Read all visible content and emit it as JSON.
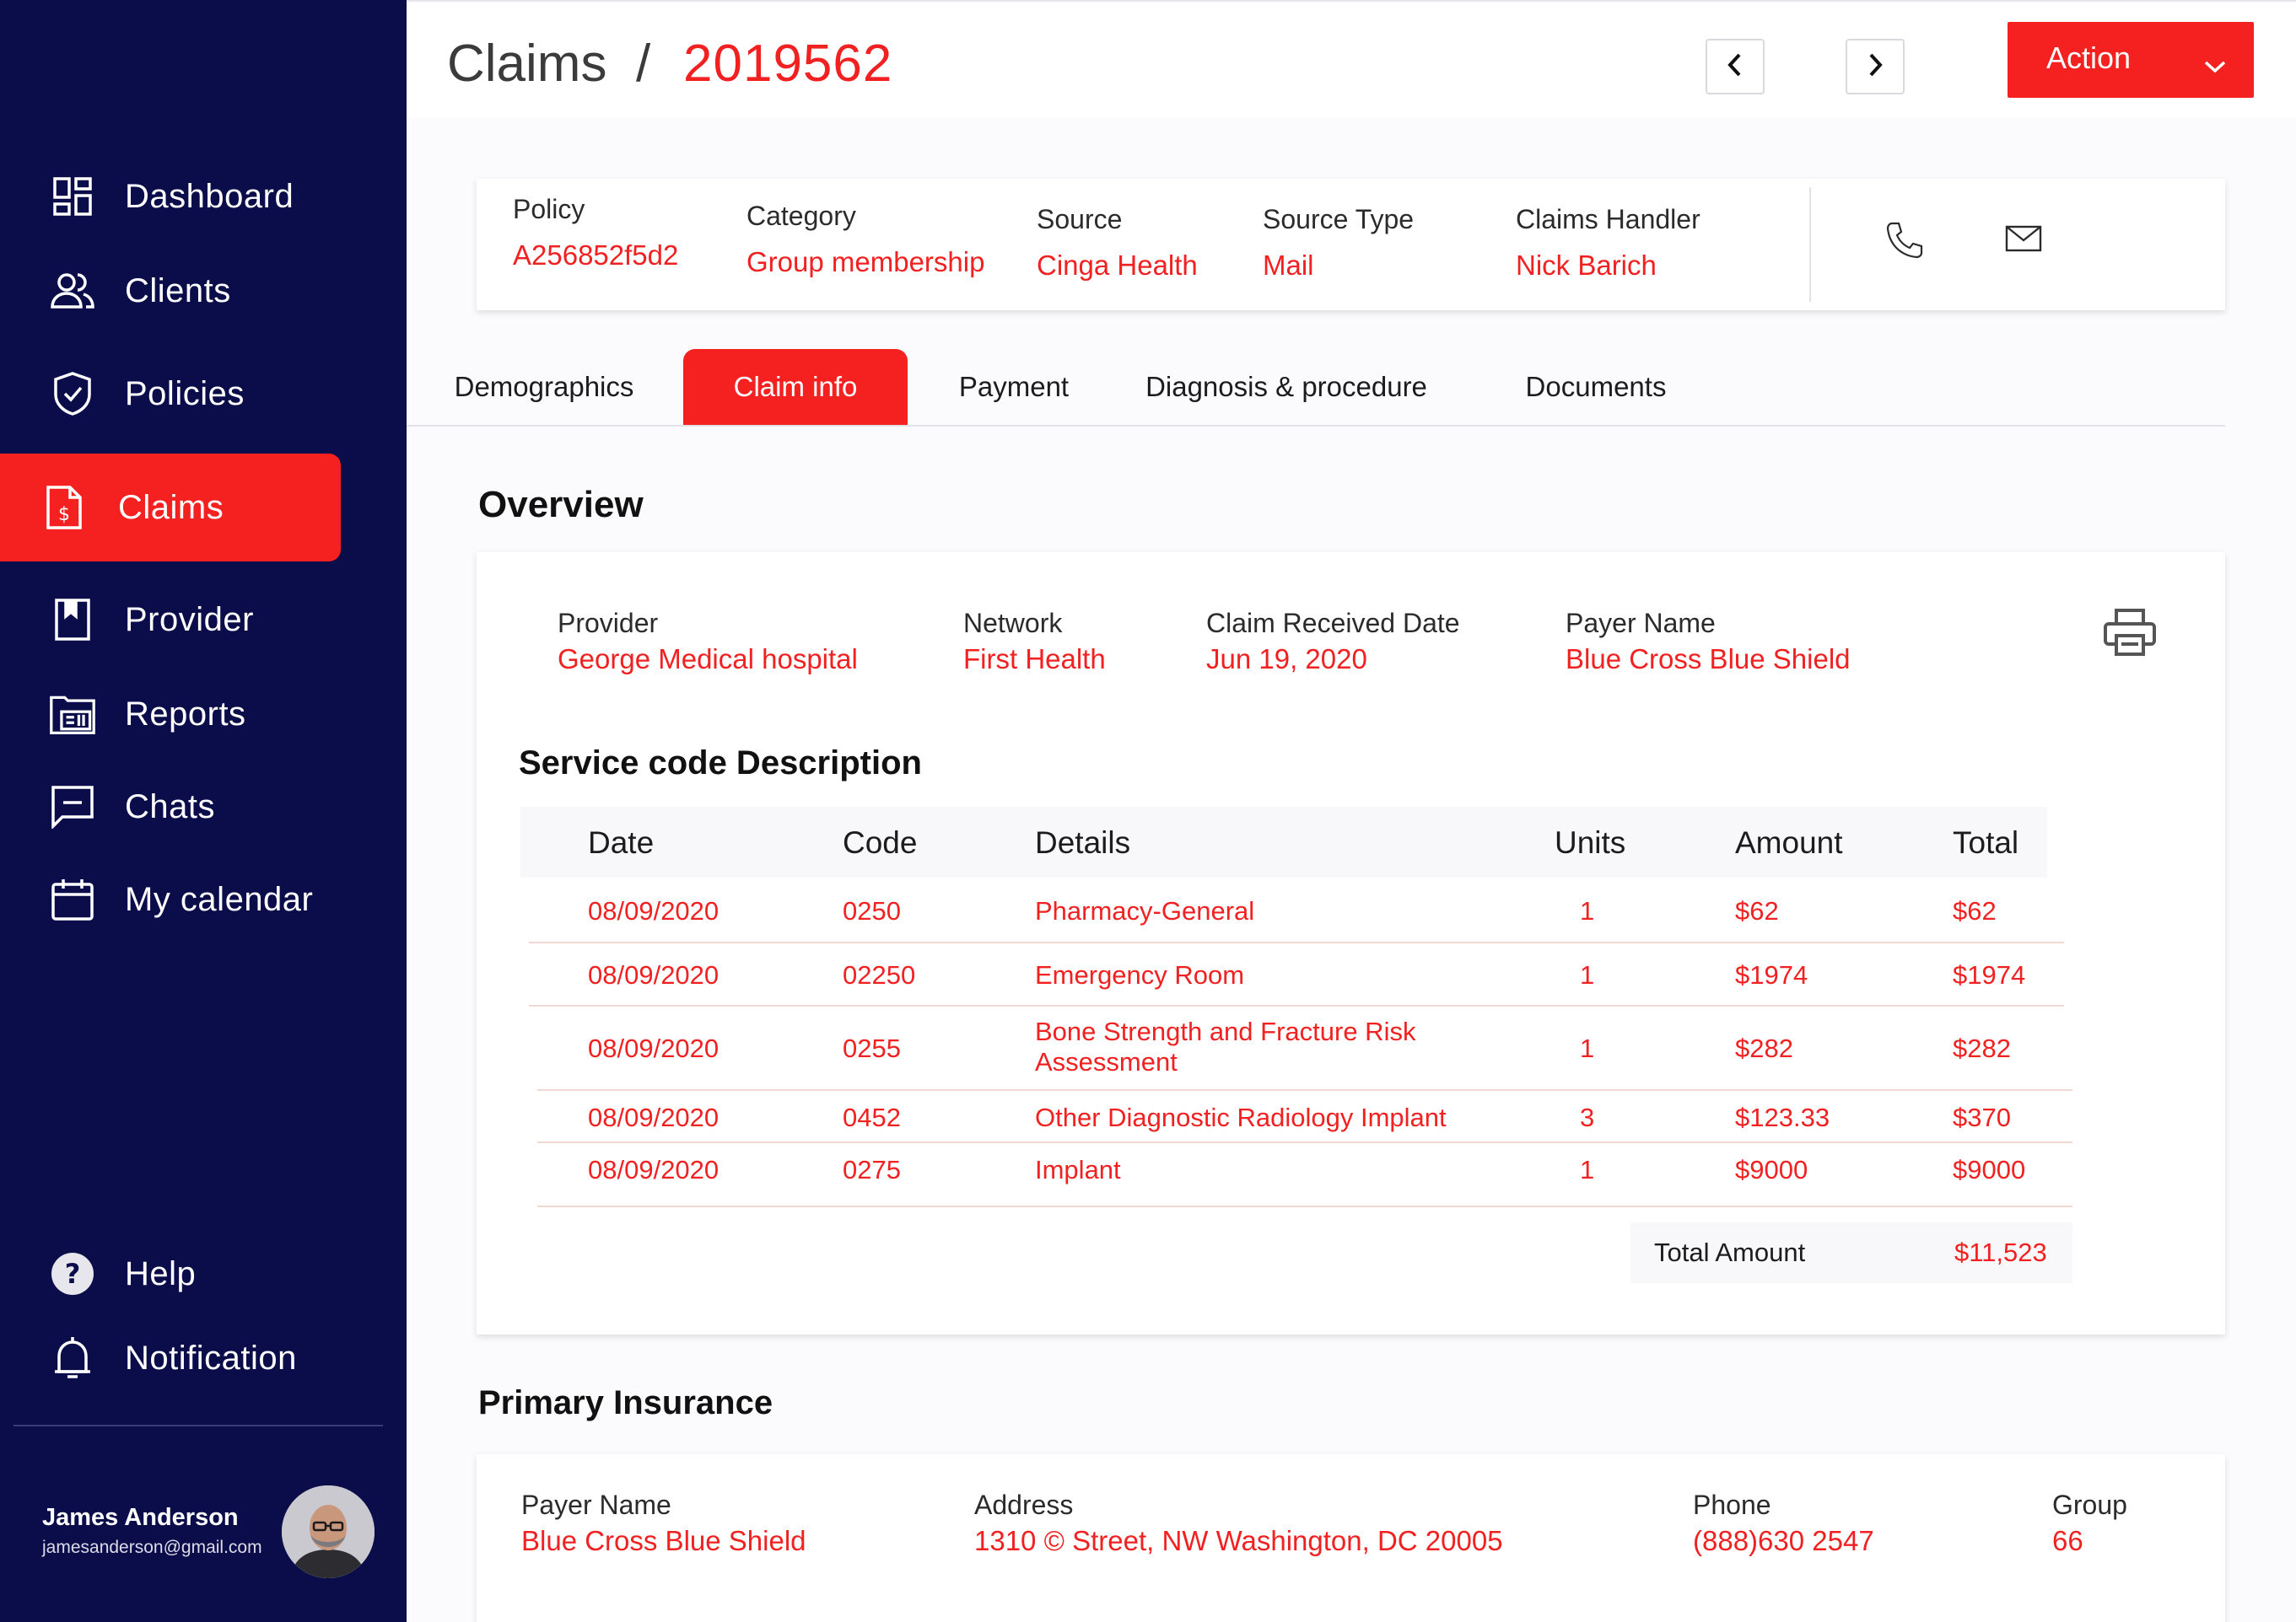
{
  "sidebar": {
    "items": [
      {
        "label": "Dashboard",
        "icon": "dashboard-icon"
      },
      {
        "label": "Clients",
        "icon": "clients-icon"
      },
      {
        "label": "Policies",
        "icon": "shield-icon"
      },
      {
        "label": "Claims",
        "icon": "claim-document-icon",
        "active": true
      },
      {
        "label": "Provider",
        "icon": "bookmark-icon"
      },
      {
        "label": "Reports",
        "icon": "reports-icon"
      },
      {
        "label": "Chats",
        "icon": "chat-icon"
      },
      {
        "label": "My calendar",
        "icon": "calendar-icon"
      }
    ],
    "bottom_items": [
      {
        "label": "Help",
        "icon": "help-icon"
      },
      {
        "label": "Notification",
        "icon": "bell-icon"
      }
    ],
    "profile": {
      "name": "James Anderson",
      "email": "jamesanderson@gmail.com"
    }
  },
  "header": {
    "crumb_root": "Claims",
    "crumb_sep": "/",
    "claim_id": "2019562",
    "action_label": "Action"
  },
  "info": {
    "policy": {
      "label": "Policy",
      "value": "A256852f5d2"
    },
    "category": {
      "label": "Category",
      "value": "Group membership"
    },
    "source": {
      "label": "Source",
      "value": "Cinga Health"
    },
    "source_type": {
      "label": "Source Type",
      "value": "Mail"
    },
    "handler": {
      "label": "Claims Handler",
      "value": "Nick Barich"
    }
  },
  "tabs": [
    "Demographics",
    "Claim info",
    "Payment",
    "Diagnosis & procedure",
    "Documents"
  ],
  "active_tab": "Claim info",
  "overview": {
    "title": "Overview",
    "provider": {
      "label": "Provider",
      "value": "George Medical hospital"
    },
    "network": {
      "label": "Network",
      "value": "First Health"
    },
    "received": {
      "label": "Claim Received Date",
      "value": "Jun 19, 2020"
    },
    "payer": {
      "label": "Payer Name",
      "value": "Blue Cross Blue Shield"
    },
    "service_title": "Service code Description",
    "columns": [
      "Date",
      "Code",
      "Details",
      "Units",
      "Amount",
      "Total"
    ],
    "rows": [
      {
        "date": "08/09/2020",
        "code": "0250",
        "details": "Pharmacy-General",
        "details2": "",
        "units": "1",
        "amount": "$62",
        "total": "$62"
      },
      {
        "date": "08/09/2020",
        "code": "02250",
        "details": "Emergency Room",
        "details2": "",
        "units": "1",
        "amount": "$1974",
        "total": "$1974"
      },
      {
        "date": "08/09/2020",
        "code": "0255",
        "details": "Bone Strength and Fracture Risk",
        "details2": "Assessment",
        "units": "1",
        "amount": "$282",
        "total": "$282"
      },
      {
        "date": "08/09/2020",
        "code": "0452",
        "details": "Other Diagnostic Radiology Implant",
        "details2": "",
        "units": "3",
        "amount": "$123.33",
        "total": "$370"
      },
      {
        "date": "08/09/2020",
        "code": "0275",
        "details": "Implant",
        "details2": "",
        "units": "1",
        "amount": "$9000",
        "total": "$9000"
      }
    ],
    "total_label": "Total Amount",
    "total_value": "$11,523"
  },
  "insurance": {
    "title": "Primary Insurance",
    "payer": {
      "label": "Payer Name",
      "value": "Blue Cross Blue Shield"
    },
    "address": {
      "label": "Address",
      "value": "1310 © Street, NW Washington, DC 20005"
    },
    "phone": {
      "label": "Phone",
      "value": "(888)630 2547"
    },
    "group": {
      "label": "Group",
      "value": "66"
    }
  },
  "colors": {
    "accent": "#f52121",
    "sidebar": "#0b0d4a"
  }
}
